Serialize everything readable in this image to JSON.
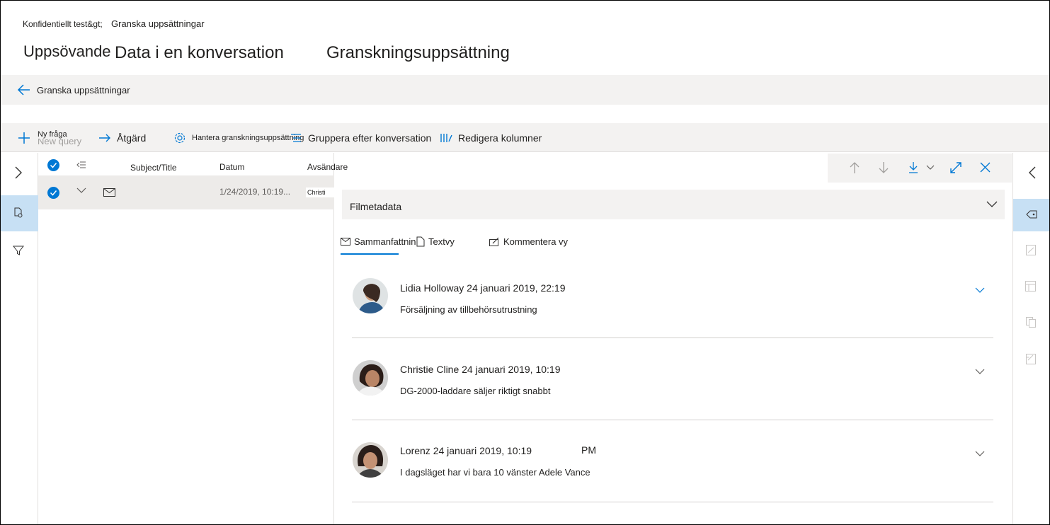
{
  "breadcrumb": {
    "first": "Konfidentiellt test&gt;",
    "second": "Granska uppsättningar"
  },
  "titles": {
    "first": "Uppsövande",
    "second": "Data i en konversation",
    "third": "Granskningsuppsättning"
  },
  "back": {
    "label": "Granska uppsättningar",
    "icon": "arrow-left-icon"
  },
  "toolbar": {
    "new_query": "Ny fråga",
    "new_query_ghost": "New query",
    "action": "Åtgärd",
    "manage": "Hantera granskningsuppsättning",
    "group": "Gruppera efter konversation",
    "edit_columns": "Redigera kolumner"
  },
  "list": {
    "columns": [
      "Subject/Title",
      "Datum",
      "Avsändare"
    ],
    "rows": [
      {
        "date": "1/24/2019, 10:19...",
        "sender": "Christi"
      }
    ]
  },
  "detail": {
    "metadata_label": "Filmetadata",
    "tabs": [
      "Sammanfattning",
      "Textvy",
      "Kommentera vy"
    ],
    "active_tab": "Sammanfattning",
    "messages": [
      {
        "from": "Lidia Holloway 24 januari 2019, 22:19",
        "extra": "",
        "body": "Försäljning av tillbehörsutrustning"
      },
      {
        "from": "Christie Cline 24 januari 2019, 10:19",
        "extra": "",
        "body": "DG-2000-laddare säljer riktigt snabbt"
      },
      {
        "from": "Lorenz 24 januari 2019, 10:19",
        "extra": "PM",
        "body": "I dagsläget har vi bara 10 vänster Adele Vance"
      }
    ]
  },
  "colors": {
    "accent": "#0078d4",
    "selection": "#c7e0f4",
    "bar": "#f3f2f1"
  }
}
